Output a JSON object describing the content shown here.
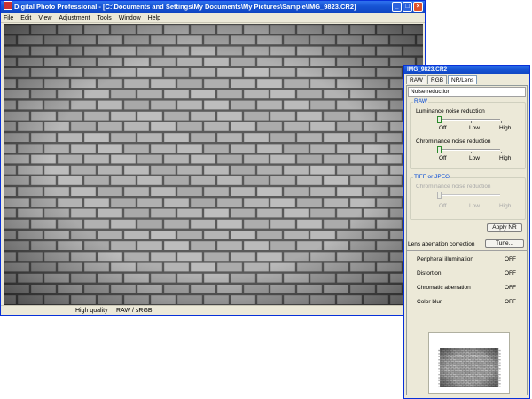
{
  "main_window": {
    "title": "Digital Photo Professional - [C:\\Documents and Settings\\My Documents\\My Pictures\\Sample\\IMG_9823.CR2]",
    "menu": [
      "File",
      "Edit",
      "View",
      "Adjustment",
      "Tools",
      "Window",
      "Help"
    ],
    "window_buttons": {
      "minimize": "_",
      "maximize": "□",
      "close": "×"
    },
    "status": {
      "quality": "High quality",
      "mode": "RAW / sRGB"
    }
  },
  "palette": {
    "title": "IMG_9823.CR2",
    "tabs": [
      "RAW",
      "RGB",
      "NR/Lens"
    ],
    "active_tab": "NR/Lens",
    "noise_reduction_header": "Noise reduction",
    "raw_group": {
      "title": "RAW",
      "luminance_label": "Luminance noise reduction",
      "luminance_value": 0,
      "chrominance_label": "Chrominance noise reduction",
      "chrominance_value": 0,
      "scale": {
        "off": "Off",
        "low": "Low",
        "high": "High"
      }
    },
    "tiff_group": {
      "title": "TIFF or JPEG",
      "chrominance_label": "Chrominance noise reduction",
      "chrominance_value": 0,
      "scale": {
        "off": "Off",
        "low": "Low",
        "high": "High"
      }
    },
    "apply_button": "Apply NR",
    "lens_header": "Lens aberration correction",
    "tune_button": "Tune...",
    "corrections": [
      {
        "label": "Peripheral illumination",
        "value": "OFF"
      },
      {
        "label": "Distortion",
        "value": "OFF"
      },
      {
        "label": "Chromatic aberration",
        "value": "OFF"
      },
      {
        "label": "Color blur",
        "value": "OFF"
      }
    ]
  },
  "colors": {
    "title_blue": "#1653d3",
    "frame": "#ece9d8",
    "group_title": "#0046d5"
  }
}
